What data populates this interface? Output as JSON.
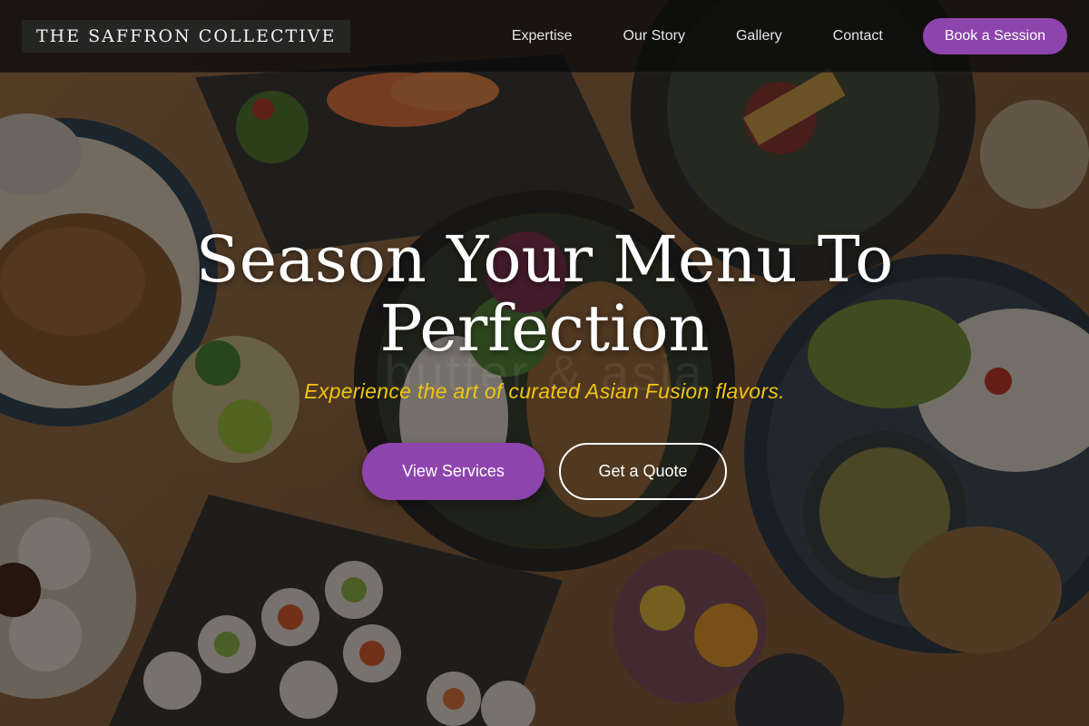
{
  "header": {
    "brand": "THE SAFFRON COLLECTIVE",
    "nav": [
      {
        "label": "Expertise"
      },
      {
        "label": "Our Story"
      },
      {
        "label": "Gallery"
      },
      {
        "label": "Contact"
      }
    ],
    "cta_label": "Book a Session"
  },
  "hero": {
    "title": "Season Your Menu To Perfection",
    "watermark": "butter & asia",
    "subtitle": "Experience the art of curated Asian Fusion flavors.",
    "primary_button": "View Services",
    "secondary_button": "Get a Quote"
  },
  "colors": {
    "accent": "#8e44ad",
    "subtitle": "#f1c40f",
    "header_bg": "#0a0a0a"
  }
}
